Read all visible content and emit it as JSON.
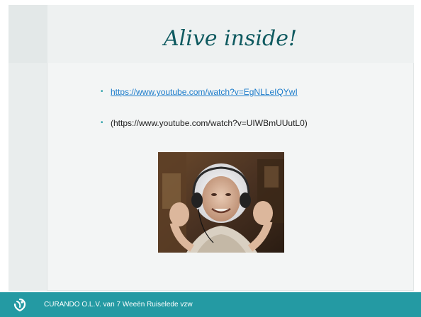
{
  "slide": {
    "title": "Alive inside!",
    "bullets": [
      {
        "text": "https://www.youtube.com/watch?v=EgNLLeIQYwI",
        "is_link": true
      },
      {
        "text": "(https://www.youtube.com/watch?v=UIWBmUUutL0)",
        "is_link": false
      }
    ],
    "image": {
      "icon": "elderly-woman-headphones-photo"
    }
  },
  "footer": {
    "logo_icon": "curando-logo-icon",
    "text": "CURANDO O.L.V. van 7 Weeën Ruiselede vzw",
    "background_color": "#249aa3"
  },
  "colors": {
    "title": "#0f5a60",
    "link": "#1c7ccb",
    "bullet": "#2aa0a8"
  }
}
